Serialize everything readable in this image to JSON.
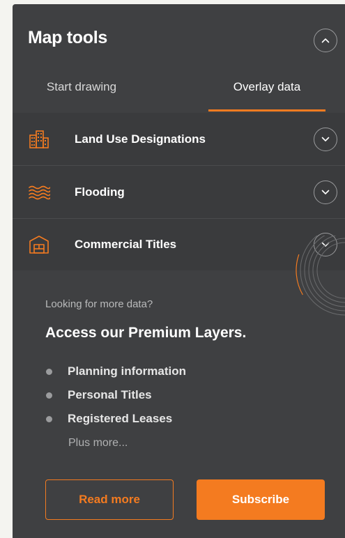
{
  "colors": {
    "accent": "#f47b20",
    "panel": "#3f4042"
  },
  "panel": {
    "title": "Map tools",
    "collapse_icon": "chevron-up-icon"
  },
  "tabs": [
    {
      "label": "Start drawing",
      "active": false
    },
    {
      "label": "Overlay data",
      "active": true
    }
  ],
  "layers": [
    {
      "label": "Land Use Designations",
      "icon": "buildings-icon",
      "toggle_icon": "chevron-down-icon"
    },
    {
      "label": "Flooding",
      "icon": "waves-icon",
      "toggle_icon": "chevron-down-icon"
    },
    {
      "label": "Commercial Titles",
      "icon": "commercial-building-icon",
      "toggle_icon": "chevron-down-icon"
    }
  ],
  "premium": {
    "eyebrow": "Looking for more data?",
    "headline": "Access our Premium Layers.",
    "features": [
      "Planning information",
      "Personal Titles",
      "Registered Leases"
    ],
    "plus_more": "Plus more...",
    "read_more_label": "Read more",
    "subscribe_label": "Subscribe"
  }
}
